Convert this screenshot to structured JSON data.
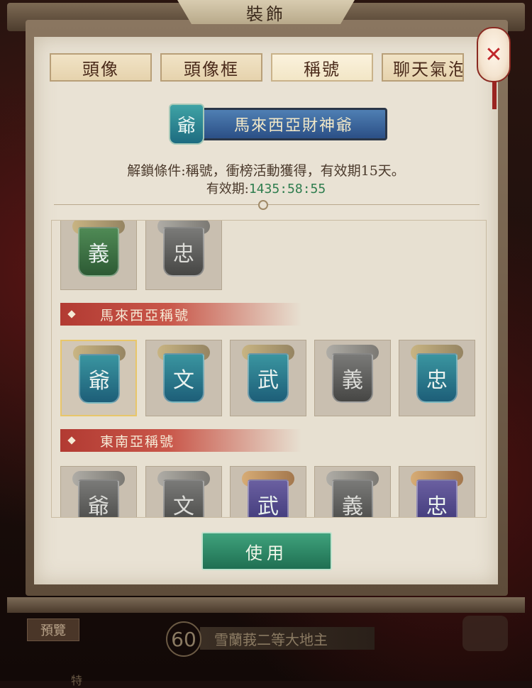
{
  "window": {
    "title": "裝飾"
  },
  "tabs": [
    {
      "label": "頭像",
      "active": false
    },
    {
      "label": "頭像框",
      "active": false
    },
    {
      "label": "稱號",
      "active": true
    },
    {
      "label": "聊天氣泡",
      "active": false
    }
  ],
  "close": {
    "glyph": "✕",
    "icon": "close-icon"
  },
  "selected_title": {
    "badge_char": "爺",
    "name": "馬來西亞財神爺",
    "unlock_condition": "解鎖條件:稱號，衝榜活動獲得，有效期15天。",
    "validity_label": "有效期:",
    "validity_value": "1435:58:55"
  },
  "list": {
    "top_partial_row": [
      {
        "char": "義",
        "color": "green"
      },
      {
        "char": "忠",
        "color": "gray"
      }
    ],
    "sections": [
      {
        "title": "馬來西亞稱號",
        "items": [
          {
            "char": "爺",
            "color": "teal",
            "selected": true
          },
          {
            "char": "文",
            "color": "teal",
            "selected": false
          },
          {
            "char": "武",
            "color": "teal",
            "selected": false
          },
          {
            "char": "義",
            "color": "gray",
            "selected": false
          },
          {
            "char": "忠",
            "color": "teal",
            "selected": false
          }
        ]
      },
      {
        "title": "東南亞稱號",
        "items": [
          {
            "char": "爺",
            "color": "gray"
          },
          {
            "char": "文",
            "color": "gray"
          },
          {
            "char": "武",
            "color": "purple"
          },
          {
            "char": "義",
            "color": "gray"
          },
          {
            "char": "忠",
            "color": "purple"
          }
        ]
      }
    ]
  },
  "use_button": {
    "label": "使用"
  },
  "bottom": {
    "preview_label": "預覽",
    "level": "60",
    "level_title": "雪蘭莪二等大地主",
    "partial_text": "特"
  },
  "colors": {
    "accent_green": "#2e7d4e",
    "section_red": "#b23a32",
    "selected_border": "#e8c66a"
  }
}
